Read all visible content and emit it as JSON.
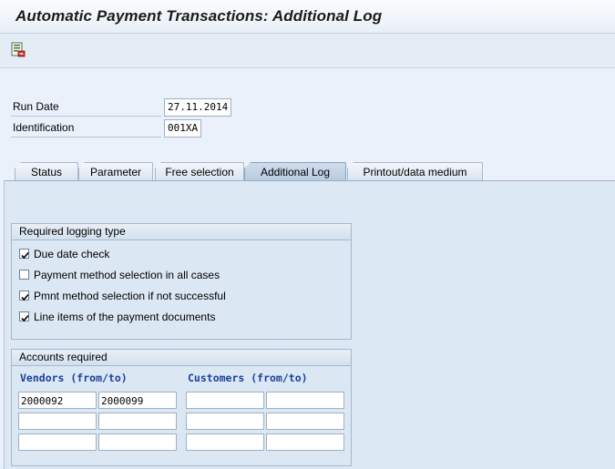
{
  "window": {
    "title": "Automatic Payment Transactions: Additional Log"
  },
  "toolbar": {
    "icon": "log-document-icon"
  },
  "header": {
    "run_date_label": "Run Date",
    "run_date_value": "27.11.2014",
    "identification_label": "Identification",
    "identification_value": "001XA"
  },
  "tabs": [
    {
      "label": "Status"
    },
    {
      "label": "Parameter"
    },
    {
      "label": "Free selection"
    },
    {
      "label": "Additional Log",
      "active": true
    },
    {
      "label": "Printout/data medium"
    }
  ],
  "logging": {
    "title": "Required logging type",
    "items": [
      {
        "label": "Due date check",
        "checked": true
      },
      {
        "label": "Payment method selection in all cases",
        "checked": false
      },
      {
        "label": "Pmnt method selection if not successful",
        "checked": true
      },
      {
        "label": "Line items of the payment documents",
        "checked": true
      }
    ]
  },
  "accounts": {
    "title": "Accounts required",
    "vendors_label": "Vendors (from/to)",
    "customers_label": "Customers (from/to)",
    "vendor_rows": [
      {
        "from": "2000092",
        "to": "2000099"
      },
      {
        "from": "",
        "to": ""
      },
      {
        "from": "",
        "to": ""
      }
    ],
    "customer_rows": [
      {
        "from": "",
        "to": ""
      },
      {
        "from": "",
        "to": ""
      },
      {
        "from": "",
        "to": ""
      }
    ]
  }
}
